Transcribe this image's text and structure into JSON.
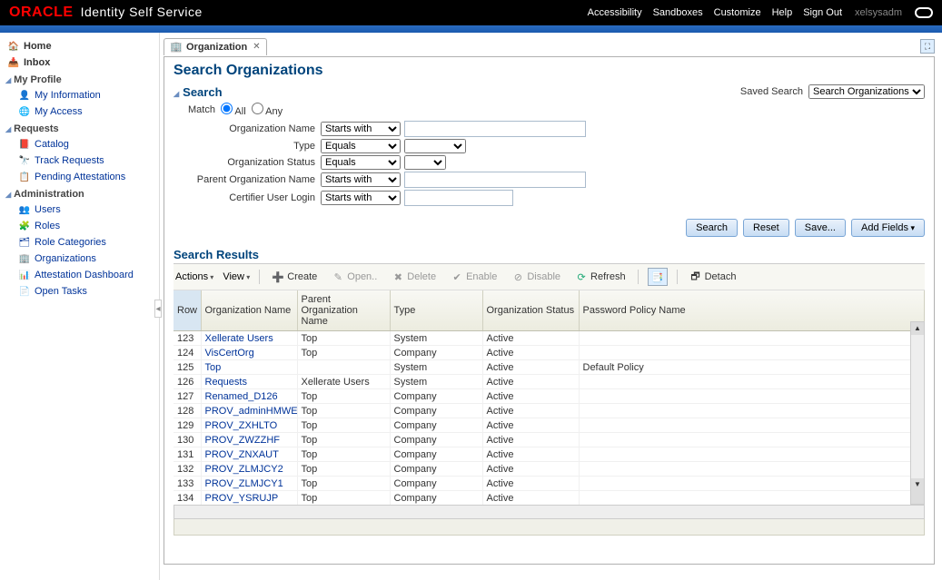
{
  "header": {
    "brand_prefix": "ORACLE",
    "title": "Identity Self Service",
    "links": [
      "Accessibility",
      "Sandboxes",
      "Customize",
      "Help",
      "Sign Out"
    ],
    "user": "xelsysadm"
  },
  "sidebar": {
    "top_items": [
      {
        "label": "Home",
        "icon": "home"
      },
      {
        "label": "Inbox",
        "icon": "inbox"
      }
    ],
    "sections": [
      {
        "title": "My Profile",
        "items": [
          {
            "label": "My Information",
            "icon": "person"
          },
          {
            "label": "My Access",
            "icon": "globe"
          }
        ]
      },
      {
        "title": "Requests",
        "items": [
          {
            "label": "Catalog",
            "icon": "book"
          },
          {
            "label": "Track Requests",
            "icon": "binoculars"
          },
          {
            "label": "Pending Attestations",
            "icon": "attest"
          }
        ]
      },
      {
        "title": "Administration",
        "items": [
          {
            "label": "Users",
            "icon": "users"
          },
          {
            "label": "Roles",
            "icon": "roles"
          },
          {
            "label": "Role Categories",
            "icon": "rolecat"
          },
          {
            "label": "Organizations",
            "icon": "org"
          },
          {
            "label": "Attestation Dashboard",
            "icon": "dashboard"
          },
          {
            "label": "Open Tasks",
            "icon": "tasks"
          }
        ]
      }
    ]
  },
  "tab": {
    "label": "Organization"
  },
  "page_title": "Search Organizations",
  "search": {
    "title": "Search",
    "saved_label": "Saved Search",
    "saved_value": "Search Organizations",
    "match_label": "Match",
    "match_all": "All",
    "match_any": "Any",
    "fields": [
      {
        "label": "Organization Name",
        "op": "Starts with",
        "wide": true
      },
      {
        "label": "Type",
        "op": "Equals",
        "select2": true
      },
      {
        "label": "Organization Status",
        "op": "Equals",
        "select2": true,
        "narrow": true
      },
      {
        "label": "Parent Organization Name",
        "op": "Starts with",
        "wide": true
      },
      {
        "label": "Certifier User Login",
        "op": "Starts with"
      }
    ],
    "buttons": {
      "search": "Search",
      "reset": "Reset",
      "save": "Save...",
      "add": "Add Fields"
    }
  },
  "results": {
    "title": "Search Results",
    "toolbar": {
      "actions": "Actions",
      "view": "View",
      "create": "Create",
      "open": "Open..",
      "delete": "Delete",
      "enable": "Enable",
      "disable": "Disable",
      "refresh": "Refresh",
      "detach": "Detach"
    },
    "columns": [
      "Row",
      "Organization Name",
      "Parent Organization Name",
      "Type",
      "Organization Status",
      "Password Policy Name"
    ],
    "rows": [
      {
        "n": 123,
        "name": "Xellerate Users",
        "parent": "Top",
        "type": "System",
        "status": "Active",
        "policy": ""
      },
      {
        "n": 124,
        "name": "VisCertOrg",
        "parent": "Top",
        "type": "Company",
        "status": "Active",
        "policy": ""
      },
      {
        "n": 125,
        "name": "Top",
        "parent": "",
        "type": "System",
        "status": "Active",
        "policy": "Default Policy"
      },
      {
        "n": 126,
        "name": "Requests",
        "parent": "Xellerate Users",
        "type": "System",
        "status": "Active",
        "policy": ""
      },
      {
        "n": 127,
        "name": "Renamed_D126",
        "parent": "Top",
        "type": "Company",
        "status": "Active",
        "policy": ""
      },
      {
        "n": 128,
        "name": "PROV_adminHMWEGS",
        "parent": "Top",
        "type": "Company",
        "status": "Active",
        "policy": ""
      },
      {
        "n": 129,
        "name": "PROV_ZXHLTO",
        "parent": "Top",
        "type": "Company",
        "status": "Active",
        "policy": ""
      },
      {
        "n": 130,
        "name": "PROV_ZWZZHF",
        "parent": "Top",
        "type": "Company",
        "status": "Active",
        "policy": ""
      },
      {
        "n": 131,
        "name": "PROV_ZNXAUT",
        "parent": "Top",
        "type": "Company",
        "status": "Active",
        "policy": ""
      },
      {
        "n": 132,
        "name": "PROV_ZLMJCY2",
        "parent": "Top",
        "type": "Company",
        "status": "Active",
        "policy": ""
      },
      {
        "n": 133,
        "name": "PROV_ZLMJCY1",
        "parent": "Top",
        "type": "Company",
        "status": "Active",
        "policy": ""
      },
      {
        "n": 134,
        "name": "PROV_YSRUJP",
        "parent": "Top",
        "type": "Company",
        "status": "Active",
        "policy": ""
      }
    ]
  }
}
